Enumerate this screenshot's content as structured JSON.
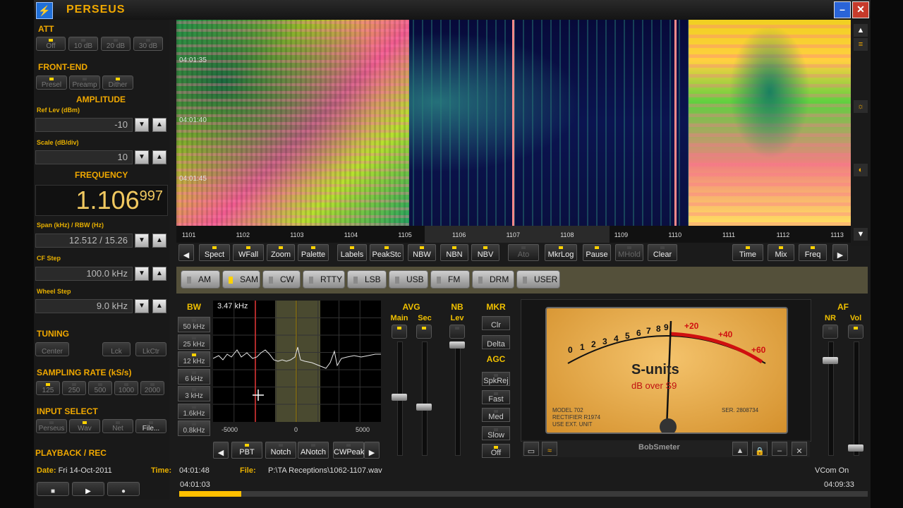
{
  "app": {
    "title": "PERSEUS"
  },
  "left": {
    "att": {
      "title": "ATT",
      "buttons": [
        "Off",
        "10 dB",
        "20 dB",
        "30 dB"
      ],
      "active": 0
    },
    "frontend": {
      "title": "FRONT-END",
      "buttons": [
        "Presel",
        "Preamp",
        "Dither"
      ],
      "active": [
        0,
        2
      ]
    },
    "amplitude": {
      "title": "AMPLITUDE",
      "ref_label": "Ref Lev (dBm)",
      "ref_value": "-10",
      "scale_label": "Scale (dB/div)",
      "scale_value": "10"
    },
    "frequency": {
      "title": "FREQUENCY",
      "main": "1.106",
      "fine": "997"
    },
    "span": {
      "label": "Span (kHz) / RBW (Hz)",
      "value": "12.512 / 15.26"
    },
    "cf_step": {
      "label": "CF Step",
      "value": "100.0 kHz"
    },
    "wheel_step": {
      "label": "Wheel Step",
      "value": "9.0 kHz"
    },
    "tuning": {
      "title": "TUNING",
      "buttons": [
        "Center",
        "Lck",
        "LkCtr"
      ]
    },
    "sampling": {
      "title": "SAMPLING RATE (kS/s)",
      "buttons": [
        "125",
        "250",
        "500",
        "1000",
        "2000"
      ],
      "active": 0
    },
    "input": {
      "title": "INPUT SELECT",
      "buttons": [
        "Perseus",
        "Wav",
        "Net",
        "File..."
      ],
      "active": 1
    },
    "playback": {
      "title": "PLAYBACK / REC"
    }
  },
  "waterfall": {
    "timestamps": [
      "04:01:35",
      "04:01:40",
      "04:01:45"
    ],
    "axis_ticks": [
      "1101",
      "1102",
      "1103",
      "1104",
      "1105",
      "1106",
      "1107",
      "1108",
      "1109",
      "1110",
      "1111",
      "1112",
      "1113"
    ]
  },
  "toolbar": {
    "buttons": [
      "Spect",
      "WFall",
      "Zoom",
      "Palette",
      "Labels",
      "PeakStc",
      "NBW",
      "NBN",
      "NBV",
      "Ato",
      "MkrLog",
      "Pause",
      "MHold",
      "Clear",
      "Time",
      "Mix",
      "Freq"
    ]
  },
  "modes": {
    "items": [
      "AM",
      "SAM",
      "CW",
      "RTTY",
      "LSB",
      "USB",
      "FM",
      "DRM",
      "USER"
    ],
    "active": 1
  },
  "bw": {
    "title": "BW",
    "items": [
      "50 kHz",
      "25 kHz",
      "12 kHz",
      "6 kHz",
      "3 kHz",
      "1.6kHz",
      "0.8kHz"
    ]
  },
  "spectrum": {
    "bw_readout": "3.47 kHz",
    "ticks": [
      "-5000",
      "0",
      "5000"
    ],
    "buttons": [
      "PBT",
      "Notch",
      "ANotch",
      "CWPeak"
    ]
  },
  "avg": {
    "title": "AVG",
    "main": "Main",
    "sec": "Sec"
  },
  "nb": {
    "title": "NB",
    "lev": "Lev"
  },
  "mkr": {
    "title": "MKR",
    "buttons": [
      "Clr",
      "Delta"
    ]
  },
  "agc": {
    "title": "AGC",
    "buttons": [
      "SpkRej",
      "Fast",
      "Med",
      "Slow",
      "Off"
    ]
  },
  "smeter": {
    "scale": [
      "0",
      "1",
      "2",
      "3",
      "4",
      "5",
      "6",
      "7",
      "8",
      "9"
    ],
    "over": [
      "+20",
      "+40",
      "+60"
    ],
    "title": "S-units",
    "subtitle": "dB over S9",
    "model_text": "MODEL 702",
    "rect_text": "RECTIFIER R1974",
    "ext_text": "USE EXT. UNIT",
    "ser_text": "SER. 2808734",
    "name": "BobSmeter"
  },
  "af": {
    "title": "AF",
    "nr": "NR",
    "vol": "Vol"
  },
  "status": {
    "date_label": "Date:",
    "date": "Fri 14-Oct-2011",
    "time_label": "Time:",
    "time": "04:01:48",
    "file_label": "File:",
    "file": "P:\\TA Receptions\\1062-1107.wav",
    "vcom": "VCom On",
    "pos_start": "04:01:03",
    "pos_end": "04:09:33",
    "progress": 0.09
  },
  "colors": {
    "accent": "#f0a800",
    "led_on": "#ffd200",
    "marker": "#ff6a6a"
  }
}
